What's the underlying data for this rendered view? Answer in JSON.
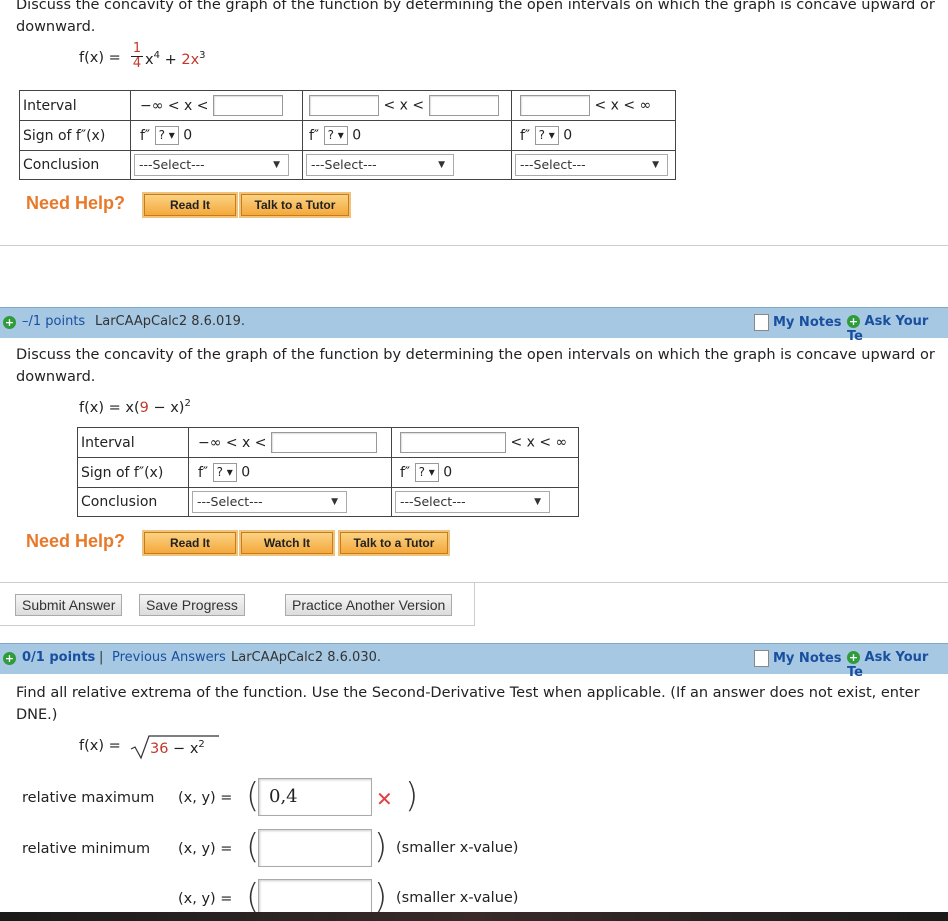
{
  "q1": {
    "text_line1": "Discuss the concavity of the graph of the function by determining the open intervals on which the graph is concave upward or",
    "text_line2": "downward.",
    "func_prefix": "f(x) = ",
    "func_num": "1",
    "func_den": "4",
    "func_x4": "x",
    "func_exp4": "4",
    "func_plus": " + ",
    "func_term2": "2x",
    "func_exp3": "3",
    "row_interval": "Interval",
    "row_sign": "Sign of f″(x)",
    "row_conclusion": "Conclusion",
    "neg_inf": "−∞ < x <",
    "mid_lt": "< x <",
    "pos_inf": "< x < ∞",
    "fpp": "f″",
    "q_mark": "? ▾",
    "zero": "0",
    "select": "---Select---",
    "need_help": "Need Help?",
    "read_it": "Read It",
    "talk_tutor": "Talk to a Tutor"
  },
  "q2": {
    "points": "–/1 points",
    "code": "LarCAApCalc2 8.6.019.",
    "my_notes": "My Notes",
    "ask_teacher": "Ask Your Te",
    "text_line1": "Discuss the concavity of the graph of the function by determining the open intervals on which the graph is concave upward or",
    "text_line2": "downward.",
    "func_prefix": "f(x) = x(",
    "func_nine": "9",
    "func_mid": " − x)",
    "func_exp": "2",
    "row_interval": "Interval",
    "row_sign": "Sign of f″(x)",
    "row_conclusion": "Conclusion",
    "neg_inf": "−∞ < x <",
    "pos_inf": "< x < ∞",
    "fpp": "f″",
    "q_mark": "? ▾",
    "zero": "0",
    "select": "---Select---",
    "need_help": "Need Help?",
    "read_it": "Read It",
    "watch_it": "Watch It",
    "talk_tutor": "Talk to a Tutor",
    "submit": "Submit Answer",
    "save": "Save Progress",
    "practice": "Practice Another Version"
  },
  "q3": {
    "points": "0/1 points",
    "sep": "|",
    "prev_answers": "Previous Answers",
    "code": "LarCAApCalc2 8.6.030.",
    "my_notes": "My Notes",
    "ask_teacher": "Ask Your Te",
    "text_line1": "Find all relative extrema of the function. Use the Second-Derivative Test when applicable. (If an answer does not exist, enter",
    "text_line2": "DNE.)",
    "func_prefix": "f(x) = ",
    "func_36": "36",
    "func_rest": " − x",
    "func_exp": "2",
    "rel_max": "relative maximum",
    "rel_min": "relative minimum",
    "xy": "(x, y) =",
    "max_value": "0,4",
    "wrong_mark": "✕",
    "smaller1": "(smaller x-value)",
    "smaller2": "(smaller x-value)"
  },
  "colors": {
    "bar": "#a6c8e3",
    "help": "#e8792a",
    "link": "#1a4fa0",
    "wrong": "#e04040"
  }
}
